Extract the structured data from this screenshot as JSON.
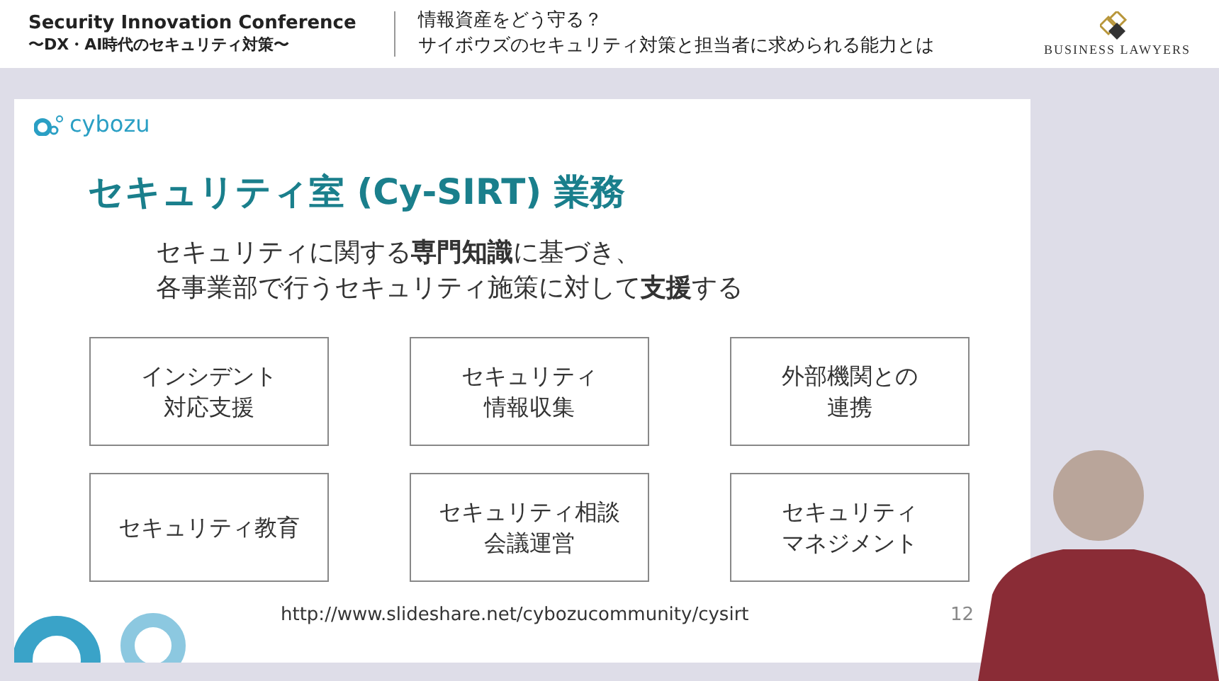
{
  "header": {
    "event_title": "Security Innovation Conference",
    "event_subtitle": "〜DX・AI時代のセキュリティ対策〜",
    "session_title_lines": [
      "情報資産をどう守る？",
      "サイボウズのセキュリティ対策と担当者に求められる能力とは"
    ],
    "brand": "BUSINESS LAWYERS"
  },
  "slide": {
    "logo": "cybozu",
    "title": "セキュリティ室 (Cy-SIRT) 業務",
    "subtitle_lines": [
      "セキュリティに関する**専門知識**に基づき、",
      "各事業部で行うセキュリティ施策に対して**支援**する"
    ],
    "boxes": [
      [
        "インシデント",
        "対応支援"
      ],
      [
        "セキュリティ",
        "情報収集"
      ],
      [
        "外部機関との",
        "連携"
      ],
      [
        "セキュリティ教育"
      ],
      [
        "セキュリティ相談",
        "会議運営"
      ],
      [
        "セキュリティ",
        "マネジメント"
      ]
    ],
    "url": "http://www.slideshare.net/cybozucommunity/cysirt",
    "page_number": "12"
  }
}
